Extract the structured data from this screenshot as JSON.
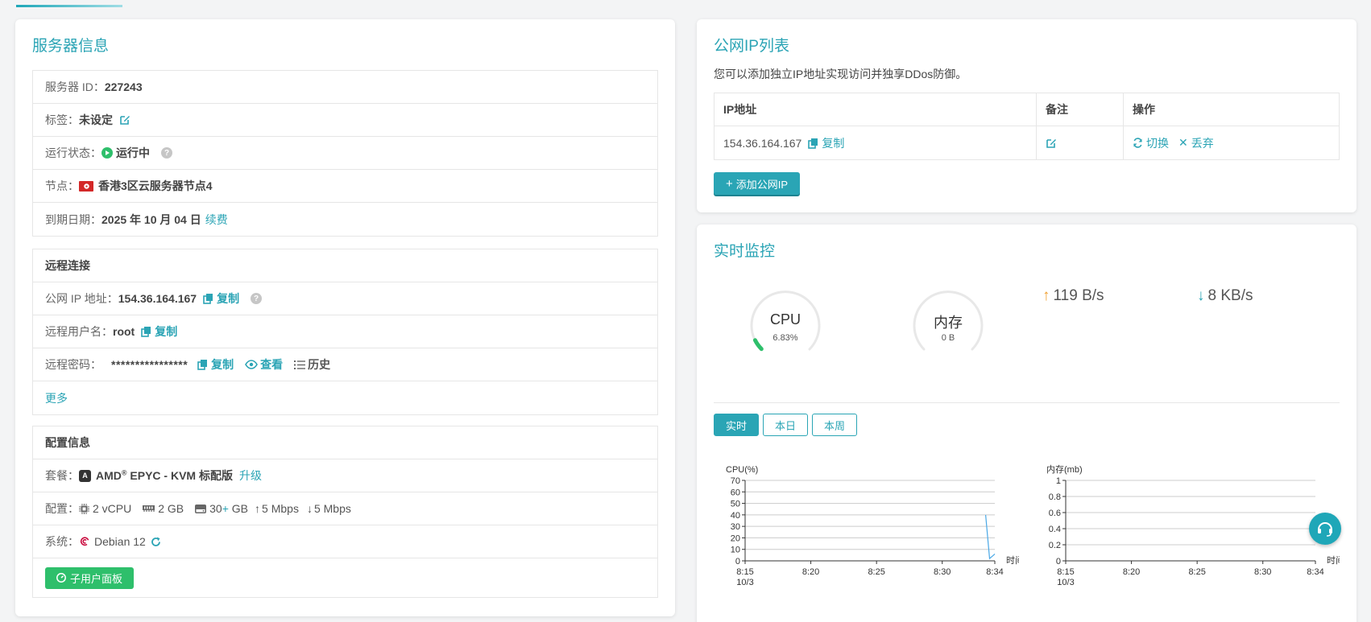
{
  "server": {
    "title": "服务器信息",
    "id_label": "服务器 ID：",
    "id_value": "227243",
    "tag_label": "标签：",
    "tag_value": "未设定",
    "status_label": "运行状态：",
    "status_value": "运行中",
    "node_label": "节点：",
    "node_value": "香港3区云服务器节点4",
    "expire_label": "到期日期：",
    "expire_value": "2025 年 10 月 04 日",
    "renew_link": "续费"
  },
  "remote": {
    "title": "远程连接",
    "ip_label": "公网 IP 地址：",
    "ip_value": "154.36.164.167",
    "user_label": "远程用户名：",
    "user_value": "root",
    "pass_label": "远程密码：",
    "pass_value": "****************",
    "copy": "复制",
    "view": "查看",
    "history": "历史",
    "more": "更多"
  },
  "config": {
    "title": "配置信息",
    "plan_label": "套餐：",
    "plan_brand": "AMD",
    "plan_sup": "®",
    "plan_value": " EPYC - KVM 标配版",
    "upgrade": "升级",
    "spec_label": "配置：",
    "cpu": "2 vCPU",
    "ram": "2 GB",
    "disk": "30",
    "disk_plus": "+",
    "disk_unit": " GB",
    "bw_up": "5 Mbps",
    "bw_down": "5 Mbps",
    "os_label": "系统：",
    "os_value": "Debian 12",
    "panel_button": "子用户面板"
  },
  "ip_list": {
    "title": "公网IP列表",
    "desc": "您可以添加独立IP地址实现访问并独享DDos防御。",
    "headers": [
      "IP地址",
      "备注",
      "操作"
    ],
    "rows": [
      {
        "ip": "154.36.164.167",
        "copy": "复制",
        "switch": "切换",
        "discard": "丢弃"
      }
    ],
    "add_button": "添加公网IP"
  },
  "monitor": {
    "title": "实时监控",
    "cpu_gauge": {
      "title": "CPU",
      "value": "6.83%",
      "percent": 6.83
    },
    "mem_gauge": {
      "title": "内存",
      "value": "0 B",
      "percent": 0
    },
    "upload": "119 B/s",
    "download": "8 KB/s",
    "tabs": [
      "实时",
      "本日",
      "本周"
    ]
  },
  "colors": {
    "accent": "#2ba4b5",
    "green": "#2ebf6b",
    "upload": "#f0a030",
    "download": "#2aa5b5"
  },
  "chart_data": [
    {
      "type": "line",
      "ylabel": "CPU(%)",
      "xlabel": "时间",
      "ylim": [
        0,
        70
      ],
      "yticks": [
        0,
        10,
        20,
        30,
        40,
        50,
        60,
        70
      ],
      "xticks": [
        "8:15",
        "8:20",
        "8:25",
        "8:30",
        "8:34"
      ],
      "x_sub_label": "10/3",
      "series": [
        {
          "x": [
            33.3,
            33.6,
            33.9,
            34.0
          ],
          "y": [
            40,
            2,
            5,
            6
          ]
        }
      ]
    },
    {
      "type": "line",
      "ylabel": "内存(mb)",
      "xlabel": "时间",
      "ylim": [
        0,
        1
      ],
      "yticks": [
        0,
        0.2,
        0.4,
        0.6,
        0.8,
        1
      ],
      "xticks": [
        "8:15",
        "8:20",
        "8:25",
        "8:30",
        "8:34"
      ],
      "x_sub_label": "10/3",
      "series": []
    }
  ]
}
